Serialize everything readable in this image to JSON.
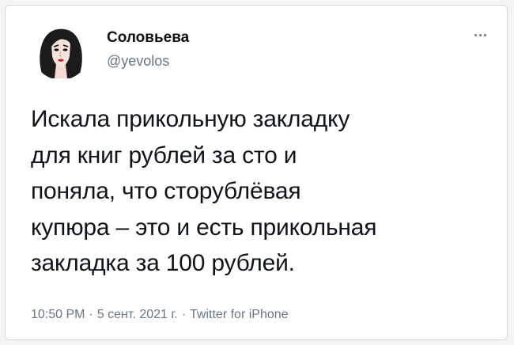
{
  "user": {
    "display_name": "Соловьева",
    "handle": "@yevolos"
  },
  "tweet": {
    "lines": [
      "Искала прикольную закладку",
      "для книг рублей за сто и",
      "поняла, что сторублёвая",
      "купюра – это и есть прикольная",
      "закладка за 100 рублей."
    ]
  },
  "meta": {
    "time": "10:50 PM",
    "separator": "·",
    "date": "5 сент. 2021 г.",
    "source": "Twitter for iPhone"
  },
  "icons": {
    "more": "more-horizontal-icon",
    "avatar": "avatar-illustration"
  },
  "colors": {
    "text": "#0f1419",
    "secondary": "#657786",
    "background": "#ffffff"
  }
}
